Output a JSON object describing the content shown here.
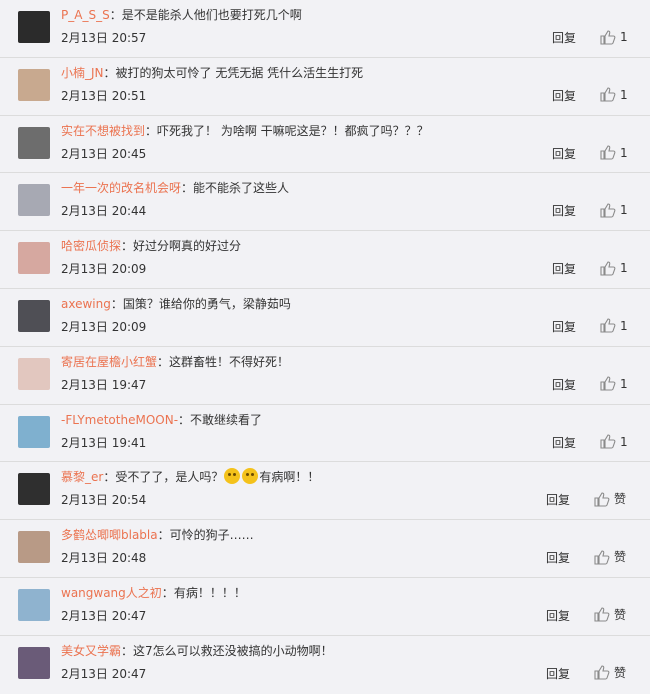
{
  "comments": [
    {
      "user": "P_A_S_S",
      "text": "是不是能杀人他们也要打死几个啊",
      "time": "2月13日 20:57",
      "reply": "回复",
      "like": "1",
      "avatar_color": "#2b2b2b"
    },
    {
      "user": "小楠_JN",
      "text": "被打的狗太可怜了 无凭无据 凭什么活生生打死",
      "time": "2月13日 20:51",
      "reply": "回复",
      "like": "1",
      "avatar_color": "#c8a98f"
    },
    {
      "user": "实在不想被找到",
      "text": "吓死我了！ 为啥啊 干嘛呢这是？！都疯了吗？？？",
      "time": "2月13日 20:45",
      "reply": "回复",
      "like": "1",
      "avatar_color": "#6d6d6d"
    },
    {
      "user": "一年一次的改名机会呀",
      "text": "能不能杀了这些人",
      "time": "2月13日 20:44",
      "reply": "回复",
      "like": "1",
      "avatar_color": "#a7a9b3"
    },
    {
      "user": "哈密瓜侦探",
      "text": "好过分啊真的好过分",
      "time": "2月13日 20:09",
      "reply": "回复",
      "like": "1",
      "avatar_color": "#d6a8a0"
    },
    {
      "user": "axewing",
      "text": "国策？谁给你的勇气，梁静茹吗",
      "time": "2月13日 20:09",
      "reply": "回复",
      "like": "1",
      "avatar_color": "#4f4f55"
    },
    {
      "user": "寄居在屋檐小红蟹",
      "text": "这群畜牲！不得好死！",
      "time": "2月13日 19:47",
      "reply": "回复",
      "like": "1",
      "avatar_color": "#e2c7bf"
    },
    {
      "user": "-FLYmetotheMOON-",
      "text": "不敢继续看了",
      "time": "2月13日 19:41",
      "reply": "回复",
      "like": "1",
      "avatar_color": "#7fb0cf"
    },
    {
      "user": "慕黎_er",
      "text": "受不了了，是人吗？",
      "text_after": "有病啊！！",
      "time": "2月13日 20:54",
      "reply": "回复",
      "like": "赞",
      "avatar_color": "#2f2f2f"
    },
    {
      "user": "多鹤怂唧唧blabla",
      "text": "可怜的狗子……",
      "time": "2月13日 20:48",
      "reply": "回复",
      "like": "赞",
      "avatar_color": "#b89a86"
    },
    {
      "user": "wangwang人之初",
      "text": "有病！！！！",
      "time": "2月13日 20:47",
      "reply": "回复",
      "like": "赞",
      "avatar_color": "#8fb3cf"
    },
    {
      "user": "美女又学霸",
      "text": "这7怎么可以救还没被搞的小动物啊！",
      "time": "2月13日 20:47",
      "reply": "回复",
      "like": "赞",
      "avatar_color": "#6a5b78"
    }
  ],
  "colors": {
    "username": "#eb7350",
    "text": "#333333",
    "background": "#f2f2f5",
    "divider": "#dcdcdc"
  }
}
